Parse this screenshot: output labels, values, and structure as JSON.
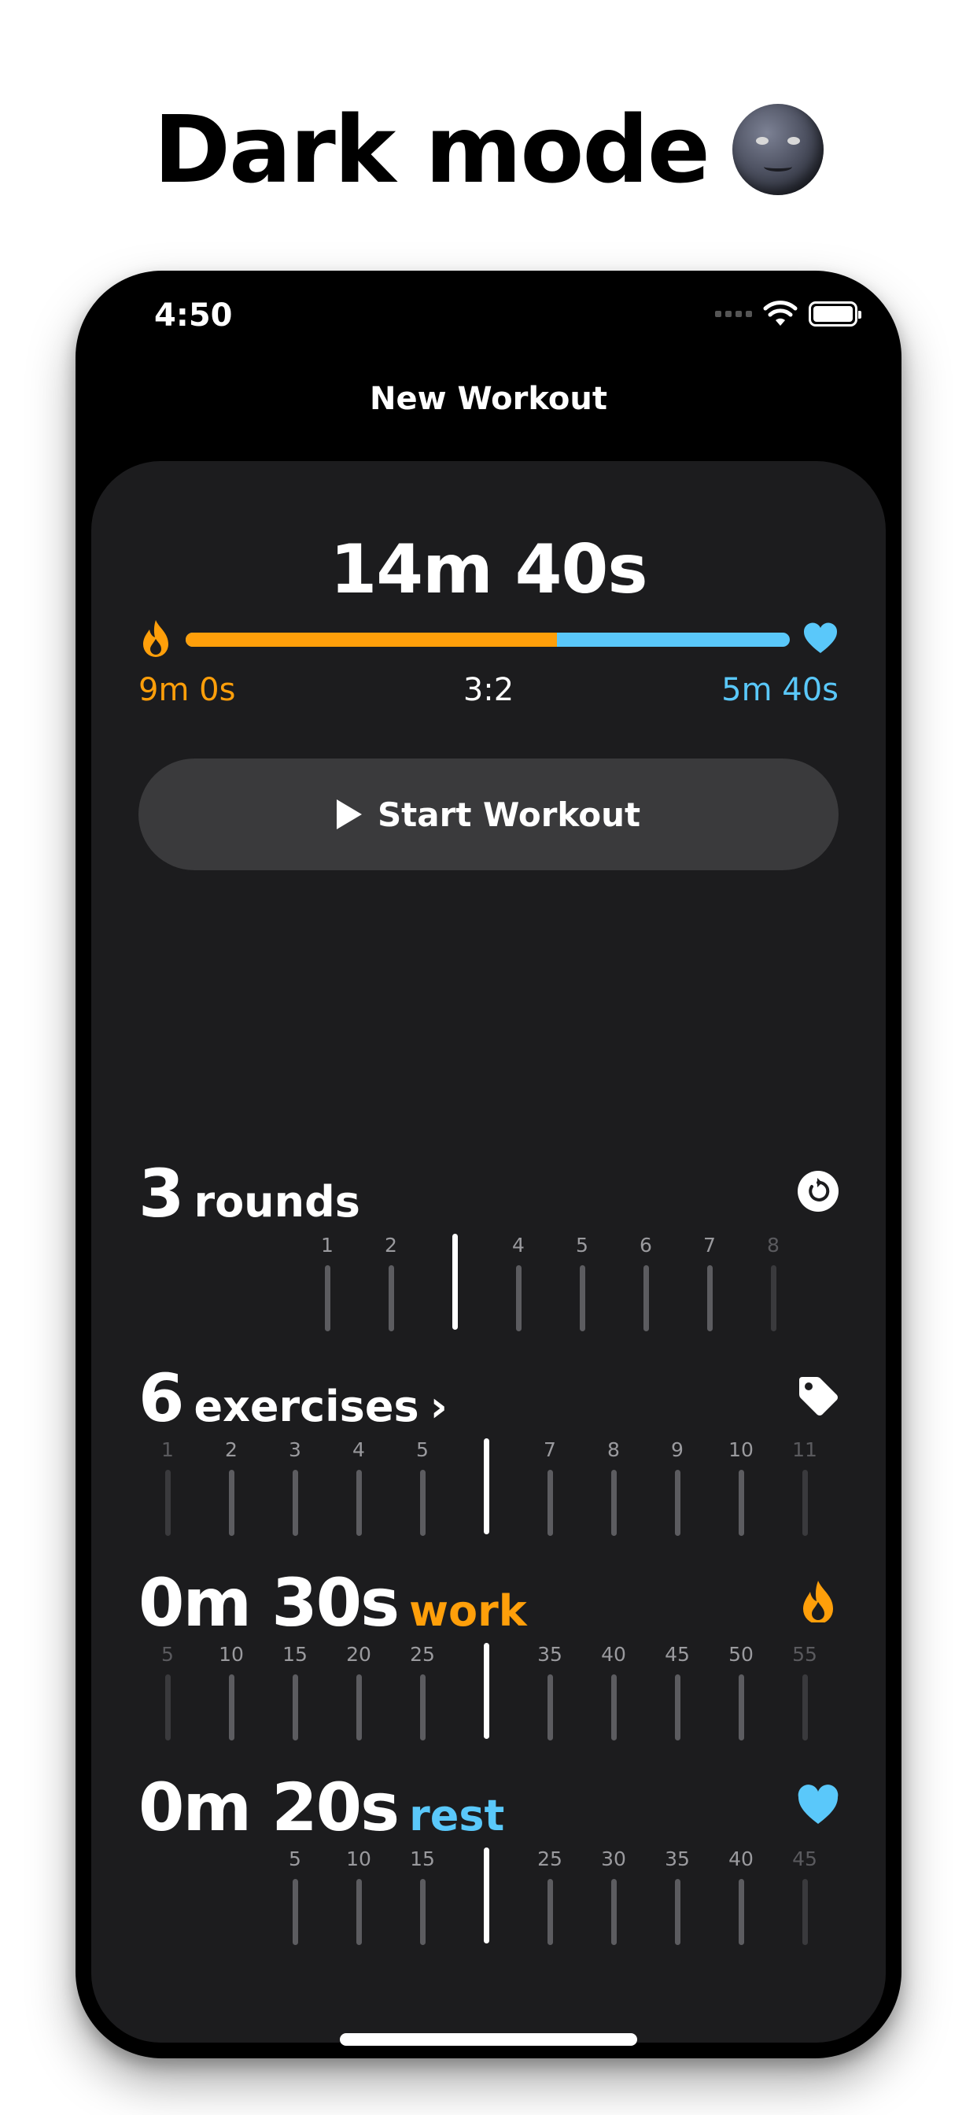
{
  "headline": {
    "text": "Dark mode",
    "emoji_icon": "new-moon-face-icon"
  },
  "status_bar": {
    "time": "4:50",
    "icons": [
      "signal-icon",
      "wifi-icon",
      "battery-icon"
    ]
  },
  "nav": {
    "title": "New Workout"
  },
  "summary": {
    "total_time": "14m 40s",
    "work_time": "9m 0s",
    "ratio": "3:2",
    "rest_time": "5m 40s",
    "work_fraction": 0.614
  },
  "start_button": {
    "label": "Start Workout",
    "icon": "play-icon"
  },
  "sections": {
    "rounds": {
      "value": "3",
      "unit": "rounds",
      "icon": "reset-icon",
      "ticks": [
        {
          "label": "1",
          "dim": false
        },
        {
          "label": "2",
          "dim": false
        },
        {
          "label": "",
          "selected": true
        },
        {
          "label": "4",
          "dim": false
        },
        {
          "label": "5",
          "dim": false
        },
        {
          "label": "6",
          "dim": false
        },
        {
          "label": "7",
          "dim": false
        },
        {
          "label": "8",
          "dim": true
        }
      ]
    },
    "exercises": {
      "value": "6",
      "unit": "exercises",
      "chevron": "›",
      "icon": "tag-icon",
      "ticks": [
        {
          "label": "1",
          "dim": true
        },
        {
          "label": "2",
          "dim": false
        },
        {
          "label": "3",
          "dim": false
        },
        {
          "label": "4",
          "dim": false
        },
        {
          "label": "5",
          "dim": false
        },
        {
          "label": "",
          "selected": true
        },
        {
          "label": "7",
          "dim": false
        },
        {
          "label": "8",
          "dim": false
        },
        {
          "label": "9",
          "dim": false
        },
        {
          "label": "10",
          "dim": false
        },
        {
          "label": "11",
          "dim": true
        }
      ]
    },
    "work": {
      "value": "0m 30s",
      "unit": "work",
      "icon": "flame-icon",
      "ticks": [
        {
          "label": "5",
          "dim": true
        },
        {
          "label": "10",
          "dim": false
        },
        {
          "label": "15",
          "dim": false
        },
        {
          "label": "20",
          "dim": false
        },
        {
          "label": "25",
          "dim": false
        },
        {
          "label": "",
          "selected": true
        },
        {
          "label": "35",
          "dim": false
        },
        {
          "label": "40",
          "dim": false
        },
        {
          "label": "45",
          "dim": false
        },
        {
          "label": "50",
          "dim": false
        },
        {
          "label": "55",
          "dim": true
        }
      ]
    },
    "rest": {
      "value": "0m 20s",
      "unit": "rest",
      "icon": "heart-icon",
      "ticks": [
        {
          "label": "5",
          "dim": false
        },
        {
          "label": "10",
          "dim": false
        },
        {
          "label": "15",
          "dim": false
        },
        {
          "label": "",
          "selected": true
        },
        {
          "label": "25",
          "dim": false
        },
        {
          "label": "30",
          "dim": false
        },
        {
          "label": "35",
          "dim": false
        },
        {
          "label": "40",
          "dim": false
        },
        {
          "label": "45",
          "dim": true
        }
      ]
    }
  },
  "colors": {
    "work": "#ff9f0a",
    "rest": "#5ac8fa",
    "sheet": "#1c1c1e",
    "button": "#3a3a3c"
  }
}
